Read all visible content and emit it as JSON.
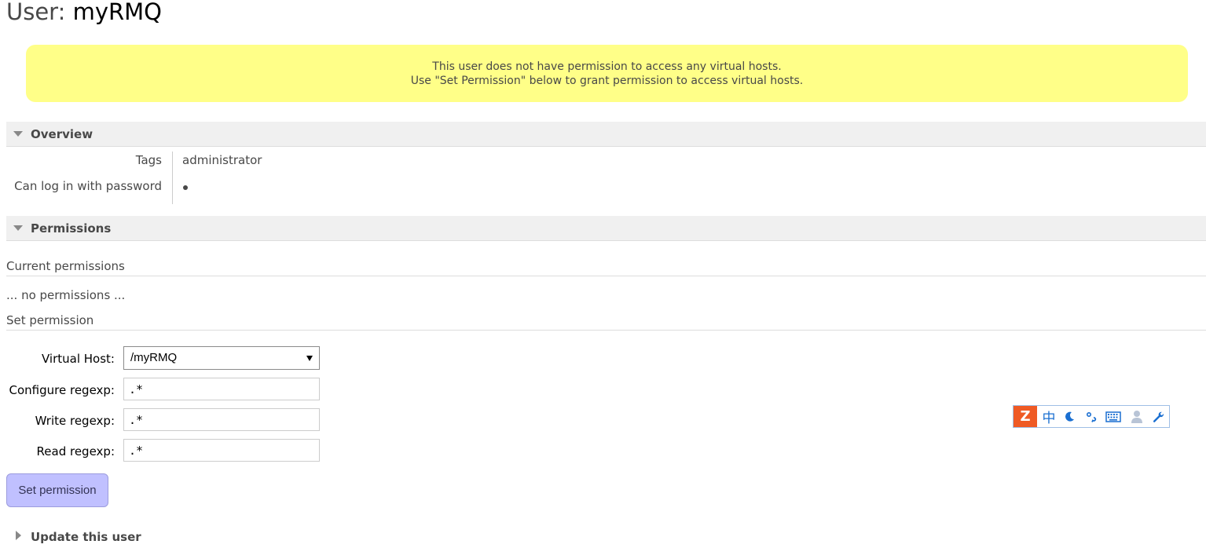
{
  "page": {
    "title_prefix": "User:",
    "title_name": "myRMQ"
  },
  "warning": {
    "line1": "This user does not have permission to access any virtual hosts.",
    "line2": "Use \"Set Permission\" below to grant permission to access virtual hosts."
  },
  "overview": {
    "header": "Overview",
    "rows": [
      {
        "label": "Tags",
        "value": "administrator"
      },
      {
        "label": "Can log in with password",
        "value": "•"
      }
    ]
  },
  "permissions": {
    "header": "Permissions",
    "current_heading": "Current permissions",
    "no_permissions": "... no permissions ...",
    "set_heading": "Set permission",
    "form": {
      "vhost_label": "Virtual Host:",
      "vhost_value": "/myRMQ",
      "configure_label": "Configure regexp:",
      "configure_value": ".*",
      "write_label": "Write regexp:",
      "write_value": ".*",
      "read_label": "Read regexp:",
      "read_value": ".*",
      "submit_label": "Set permission"
    }
  },
  "update_user": {
    "header": "Update this user"
  },
  "ime_toolbar": {
    "logo": "Z",
    "icons": [
      "sogou-logo-icon",
      "chinese-mode-icon",
      "moon-icon",
      "punctuation-icon",
      "keyboard-icon",
      "user-icon",
      "wrench-icon"
    ],
    "mode_char": "中",
    "accent": "#ef5a24"
  }
}
